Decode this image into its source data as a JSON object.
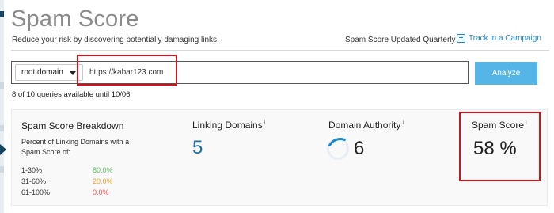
{
  "header": {
    "title": "Spam Score",
    "subtitle": "Reduce your risk by discovering potentially damaging links.",
    "updated_text": "Spam Score Updated Quarterly",
    "track_link": "Track in a Campaign"
  },
  "search": {
    "scope": "root domain",
    "url_value": "https://kabar123.com",
    "analyze_label": "Analyze"
  },
  "queries_text": "8 of 10 queries available until 10/06",
  "breakdown": {
    "title": "Spam Score Breakdown",
    "description": "Percent of Linking Domains with a Spam Score of:",
    "rows": [
      {
        "range": "1-30%",
        "percent": "80.0%",
        "color": "#5cb85c"
      },
      {
        "range": "31-60%",
        "percent": "20.0%",
        "color": "#f0a030"
      },
      {
        "range": "61-100%",
        "percent": "0.0%",
        "color": "#e05050"
      }
    ]
  },
  "linking_domains": {
    "label": "Linking Domains",
    "info": "i",
    "value": "5"
  },
  "domain_authority": {
    "label": "Domain Authority",
    "info": "i",
    "value": "6"
  },
  "spam_score": {
    "label": "Spam Score",
    "info": "i",
    "value": "58 %"
  }
}
